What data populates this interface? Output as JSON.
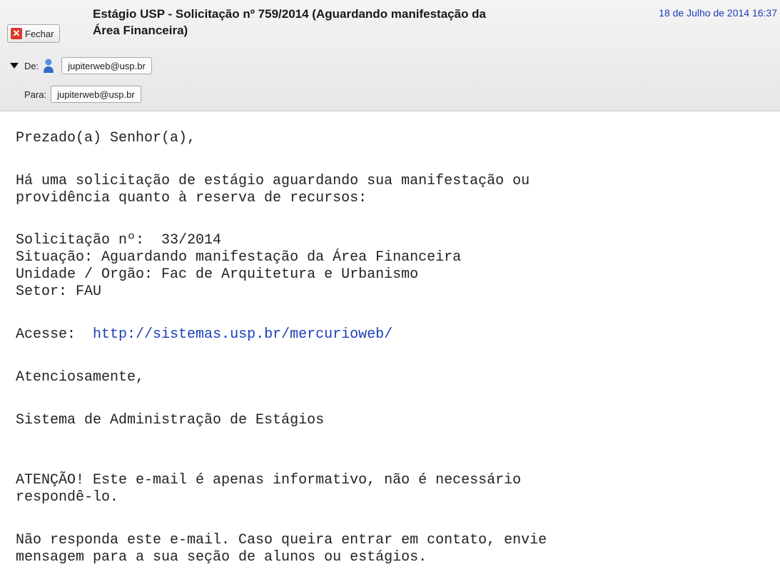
{
  "header": {
    "close_label": "Fechar",
    "subject_line1": "Estágio USP - Solicitação nº 759/2014 (Aguardando manifestação da",
    "subject_line2": "Área Financeira)",
    "date": "18 de Julho de 2014 16:37",
    "from_label": "De:",
    "from_address": "jupiterweb@usp.br",
    "to_label": "Para:",
    "to_address": "jupiterweb@usp.br",
    "accent_link_color": "#1a3fb8",
    "close_icon_color": "#d93a2b"
  },
  "body": {
    "greeting": "Prezado(a) Senhor(a),",
    "intro_line1": "Há uma solicitação de estágio aguardando sua manifestação ou",
    "intro_line2": "providência quanto à reserva de recursos:",
    "request_label": "Solicitação nº:  ",
    "request_number": "33/2014",
    "status": "Situação: Aguardando manifestação da Área Financeira",
    "unit": "Unidade / Orgão: Fac de Arquitetura e Urbanismo",
    "sector": "Setor: FAU",
    "access_label": "Acesse:  ",
    "access_url": "http://sistemas.usp.br/mercurioweb/",
    "closing": "Atenciosamente,",
    "signature": "Sistema de Administração de Estágios",
    "warning_line1": "ATENÇÃO! Este e-mail é apenas informativo, não é necessário",
    "warning_line2": "respondê-lo.",
    "noreply_line1": "Não responda este e-mail. Caso queira entrar em contato, envie",
    "noreply_line2": "mensagem para a sua seção de alunos ou estágios."
  }
}
